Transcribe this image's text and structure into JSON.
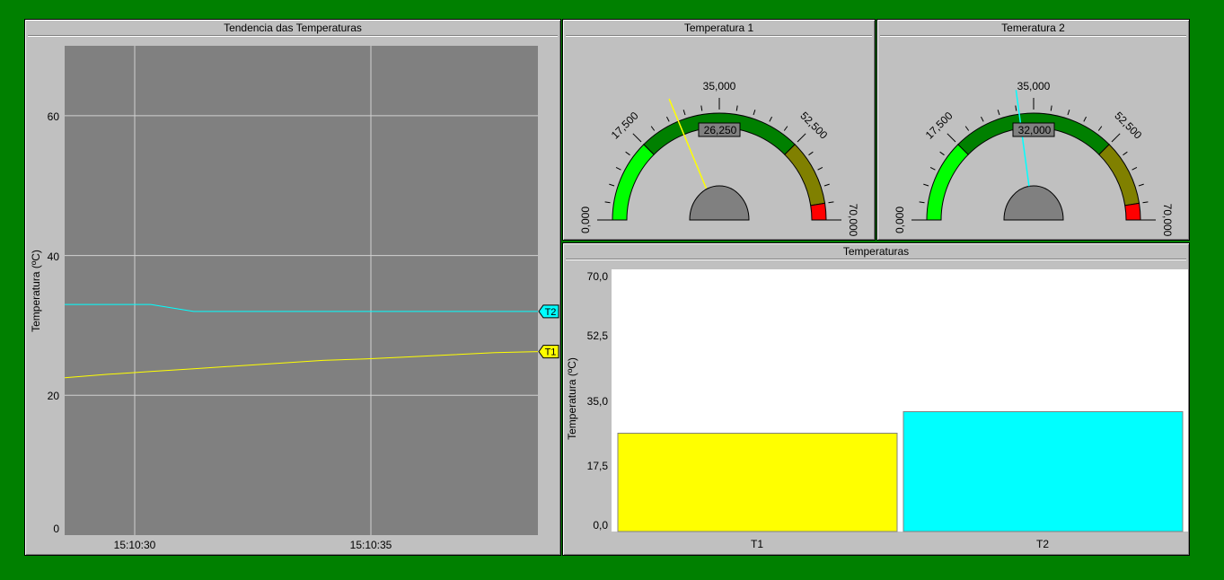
{
  "trend": {
    "title": "Tendencia das Temperaturas",
    "ylabel": "Temperatura (ºC)",
    "y_ticks": [
      "60",
      "40",
      "20",
      "0"
    ],
    "x_ticks": [
      "15:10:30",
      "15:10:35"
    ],
    "pen1_tag": "T1",
    "pen2_tag": "T2"
  },
  "gauge1": {
    "title": "Temperatura 1",
    "readout": "26,250",
    "labels": [
      "0,000",
      "17,500",
      "35,000",
      "52,500",
      "70,000"
    ],
    "value": 26.25,
    "min": 0,
    "max": 70,
    "needle_color": "#ffff00"
  },
  "gauge2": {
    "title": "Temeratura 2",
    "readout": "32,000",
    "labels": [
      "0,000",
      "17,500",
      "35,000",
      "52,500",
      "70,000"
    ],
    "value": 32.0,
    "min": 0,
    "max": 70,
    "needle_color": "#00ffff"
  },
  "bars": {
    "title": "Temperaturas",
    "ylabel": "Temperatura (ºC)",
    "y_ticks": [
      "70,0",
      "52,5",
      "35,0",
      "17,5",
      "0,0"
    ],
    "categories": [
      "T1",
      "T2"
    ]
  },
  "chart_data": [
    {
      "type": "line",
      "title": "Tendencia das Temperaturas",
      "ylabel": "Temperatura (ºC)",
      "xlabel": "",
      "ylim": [
        0,
        70
      ],
      "x_ticks": [
        "15:10:30",
        "15:10:35"
      ],
      "grid": true,
      "series": [
        {
          "name": "T1",
          "color": "#ffff00",
          "values": [
            22.5,
            23.0,
            23.4,
            23.8,
            24.2,
            24.6,
            25.0,
            25.2,
            25.5,
            25.8,
            26.1,
            26.25
          ]
        },
        {
          "name": "T2",
          "color": "#00ffff",
          "values": [
            33.0,
            33.0,
            33.0,
            32.0,
            32.0,
            32.0,
            32.0,
            32.0,
            32.0,
            32.0,
            32.0,
            32.0
          ]
        }
      ]
    },
    {
      "type": "bar",
      "title": "Temperaturas",
      "ylabel": "Temperatura (ºC)",
      "xlabel": "",
      "categories": [
        "T1",
        "T2"
      ],
      "values": [
        26.25,
        32.0
      ],
      "colors": [
        "#ffff00",
        "#00ffff"
      ],
      "ylim": [
        0,
        70
      ]
    }
  ]
}
